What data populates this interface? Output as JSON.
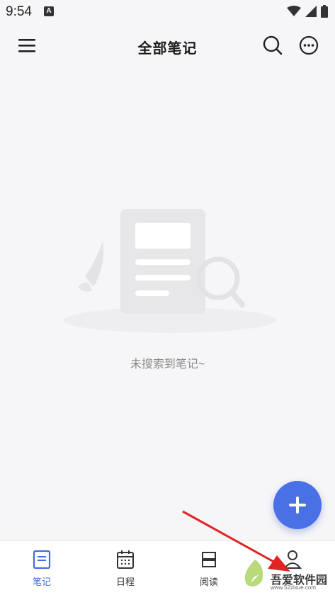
{
  "status": {
    "time": "9:54",
    "notification_badge": "A"
  },
  "header": {
    "title": "全部笔记",
    "icons": [
      "menu-icon",
      "search-icon",
      "more-icon"
    ]
  },
  "empty_state": {
    "message": "未搜索到笔记~"
  },
  "fab": {
    "icon": "plus-icon",
    "color": "#4a70e6"
  },
  "bottom_nav": {
    "items": [
      {
        "label": "笔记",
        "icon": "note-icon",
        "active": true
      },
      {
        "label": "日程",
        "icon": "calendar-icon",
        "active": false
      },
      {
        "label": "阅读",
        "icon": "reading-icon",
        "active": false
      },
      {
        "label": "",
        "icon": "profile-icon",
        "active": false
      }
    ],
    "active_color": "#3f6fe0"
  },
  "watermark": {
    "brand": "吾爱软件园",
    "url": "www.52zixue.com"
  }
}
